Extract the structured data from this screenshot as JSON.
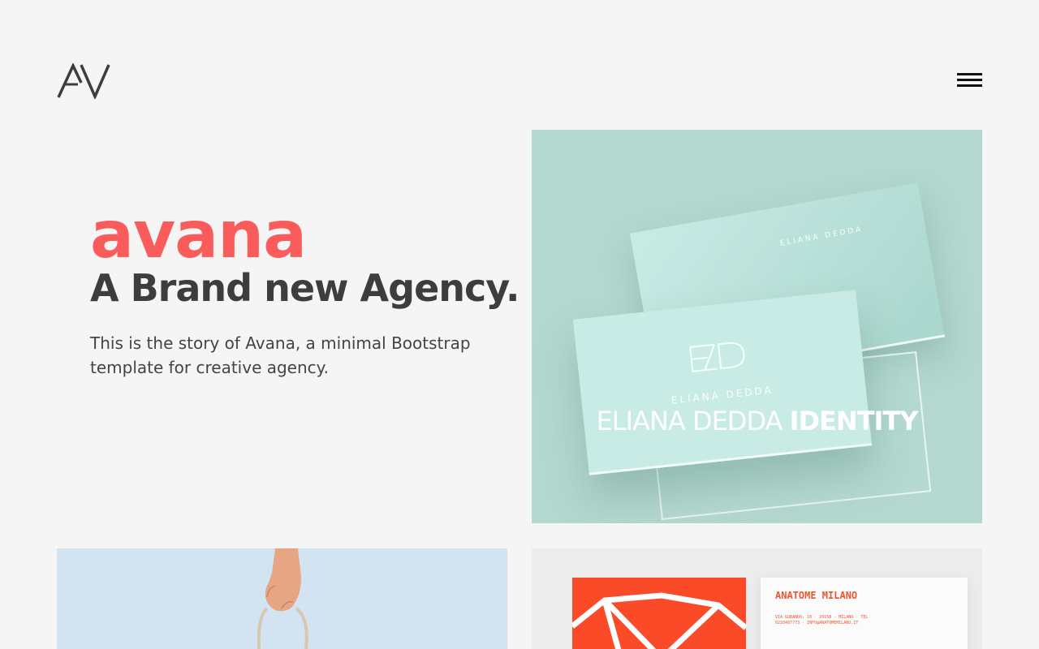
{
  "header": {
    "logo_text": "AV",
    "menu_icon": "hamburger-menu-icon"
  },
  "hero": {
    "brand": "avana",
    "headline": "A Brand new Agency.",
    "intro": "This is the story of Avana, a minimal Bootstrap template for creative agency."
  },
  "portfolio": {
    "items": [
      {
        "title_light": "ELIANA DEDDA",
        "title_bold": "IDENTITY",
        "card_text_1": "ELIANA DEDDA",
        "card_text_2": "ELIANA DEDDA"
      },
      {
        "image": "hand-holding-bag"
      },
      {
        "card_name": "ANATOME MILANO",
        "card_address": "VIA GUBANDO, 10 · 20158 - MILANO · TEL 0233487773 · INFO@ANATOMEMILANO.IT"
      }
    ]
  },
  "colors": {
    "background": "#f5f5f5",
    "brand_accent": "#fa5b5b",
    "text_dark": "#3d3d3d",
    "identity_card_bg": "#b4d8d0",
    "hand_card_bg": "#d2e3f2",
    "anatome_orange": "#fa4a28"
  }
}
